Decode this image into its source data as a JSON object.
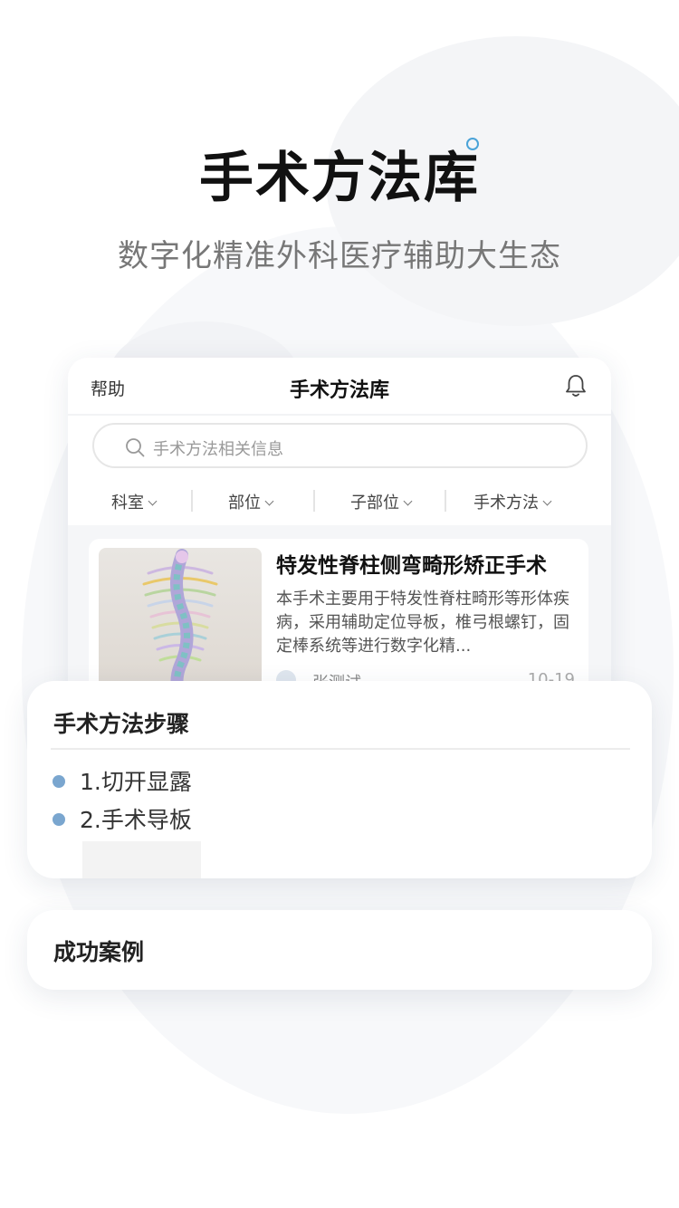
{
  "hero": {
    "title": "手术方法库",
    "subtitle": "数字化精准外科医疗辅助大生态"
  },
  "app": {
    "help_label": "帮助",
    "title": "手术方法库",
    "notification_icon": "bell-icon",
    "search": {
      "placeholder": "手术方法相关信息",
      "icon": "search-icon"
    },
    "filters": [
      {
        "label": "科室"
      },
      {
        "label": "部位"
      },
      {
        "label": "子部位"
      },
      {
        "label": "手术方法"
      }
    ],
    "list": [
      {
        "title": "特发性脊柱侧弯畸形矫正手术",
        "description": "本手术主要用于特发性脊柱畸形等形体疾病，采用辅助定位导板，椎弓根螺钉，固定棒系统等进行数字化精...",
        "author": "张测试",
        "date": "10-19"
      }
    ]
  },
  "steps": {
    "title": "手术方法步骤",
    "items": [
      {
        "label": "1.切开显露"
      },
      {
        "label": "2.手术导板"
      }
    ]
  },
  "cases": {
    "title": "成功案例"
  },
  "colors": {
    "accent": "#4aa3d8",
    "step_dot": "#7aa6cf"
  }
}
